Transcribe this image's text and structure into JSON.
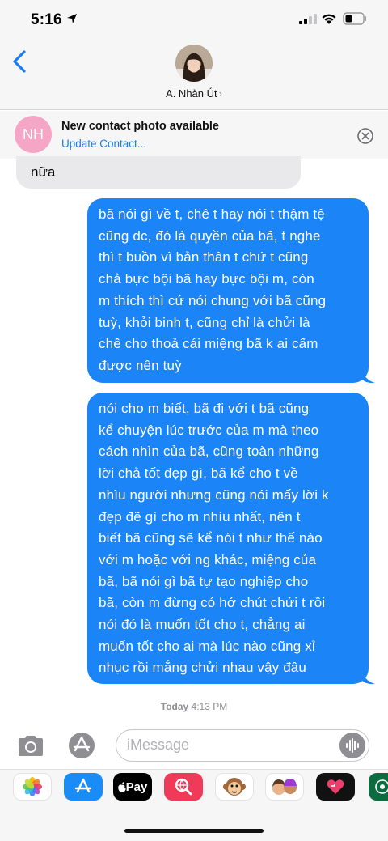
{
  "status_bar": {
    "time": "5:16"
  },
  "header": {
    "contact_name": "A. Nhàn Út",
    "chevron": "›"
  },
  "banner": {
    "initials": "NH",
    "title": "New contact photo available",
    "action": "Update Contact..."
  },
  "messages": {
    "previous_tail_text": "nữa",
    "bubble1": "bã nói gì về t, chê t hay nói t thậm tệ\ncũng dc, đó là quyền của bã, t nghe\nthì t buồn vì bản thân t chứ t cũng\nchả bực bội bã hay bực bội m, còn\nm thích thì cứ nói chung với bã cũng\ntuỳ, khỏi binh t, cũng chỉ là chửi là\nchê cho thoả cái miệng bã k ai cấm\nđược nên tuỳ",
    "bubble2": "nói cho m biết, bã đi với t bã cũng\nkể chuyện lúc trước của m mà theo\ncách nhìn của bã, cũng toàn những\nlời chả tốt đẹp gì, bã kể cho t về\nnhìu người nhưng cũng nói mấy lời k\nđẹp đẽ gì cho m nhìu nhất, nên t\nbiết bã cũng sẽ kể nói t như thế nào\nvới m hoặc với ng khác, miệng của\nbã, bã nói gì bã tự tạo nghiệp cho\nbã, còn m đừng có hở chút chửi t rồi\nnói đó là muốn tốt cho t, chẳng ai\nmuốn tốt cho ai mà lúc nào cũng xỉ\nnhục rồi mắng chửi nhau vậy đâu",
    "timestamp_day": "Today",
    "timestamp_time": "4:13 PM"
  },
  "composer": {
    "placeholder": "iMessage"
  },
  "app_drawer": {
    "applepay_label": "Pay",
    "icons": [
      "photos-icon",
      "app-store-icon",
      "apple-pay-icon",
      "image-search-icon",
      "animoji-icon",
      "memoji-icon",
      "heart-app-icon",
      "starbucks-icon"
    ]
  },
  "colors": {
    "sent_bubble": "#1b84f7",
    "received_bubble": "#e9e9eb",
    "link": "#1a7cf2",
    "banner_avatar": "#f5a5c6"
  }
}
